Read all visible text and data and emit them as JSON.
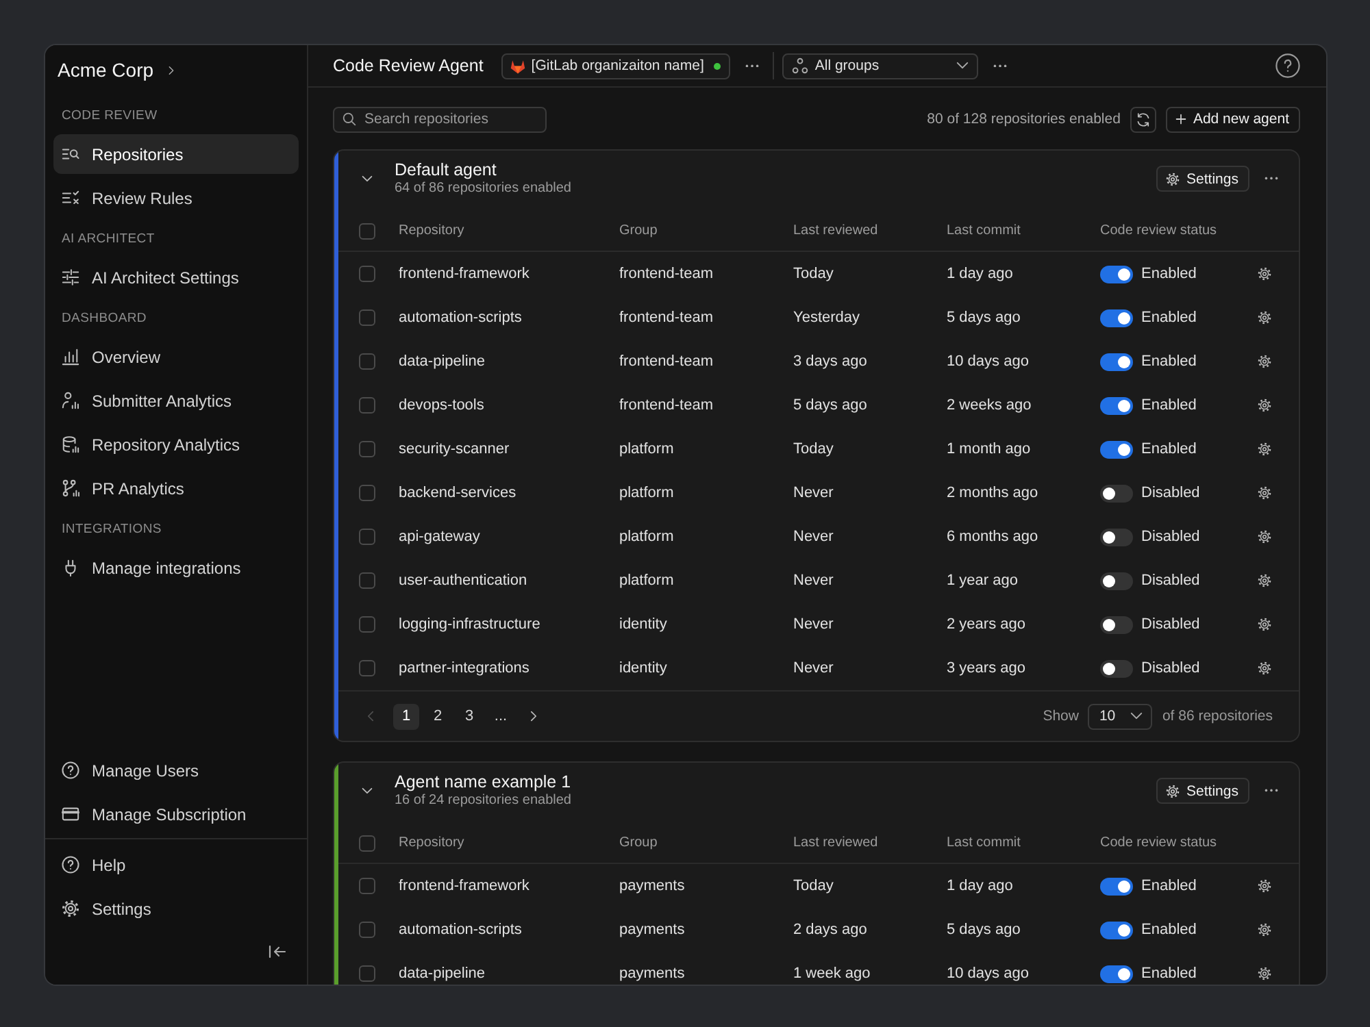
{
  "sidebar": {
    "org_name": "Acme Corp",
    "sections": [
      {
        "heading": "CODE REVIEW",
        "items": [
          {
            "label": "Repositories",
            "selected": true
          },
          {
            "label": "Review Rules",
            "selected": false
          }
        ]
      },
      {
        "heading": "AI ARCHITECT",
        "items": [
          {
            "label": "AI Architect Settings",
            "selected": false
          }
        ]
      },
      {
        "heading": "DASHBOARD",
        "items": [
          {
            "label": "Overview",
            "selected": false
          },
          {
            "label": "Submitter Analytics",
            "selected": false
          },
          {
            "label": "Repository Analytics",
            "selected": false
          },
          {
            "label": "PR Analytics",
            "selected": false
          }
        ]
      },
      {
        "heading": "INTEGRATIONS",
        "items": [
          {
            "label": "Manage integrations",
            "selected": false
          }
        ]
      }
    ],
    "bottom_items": [
      {
        "label": "Manage Users",
        "selected": false
      },
      {
        "label": "Manage Subscription",
        "selected": false
      }
    ],
    "footer_items": [
      {
        "label": "Help",
        "selected": false
      },
      {
        "label": "Settings",
        "selected": false
      }
    ]
  },
  "header": {
    "title": "Code Review Agent",
    "organization": {
      "name": "[GitLab organizaiton name]",
      "connected": true
    },
    "group_filter": {
      "value": "All groups"
    }
  },
  "toolbar": {
    "search": {
      "placeholder": "Search repositories"
    },
    "summary": "80 of 128 repositories enabled",
    "add_button": "Add new agent"
  },
  "agents": [
    {
      "name": "Default agent",
      "summary": "64 of 86 repositories enabled",
      "color": "#2f5fd8",
      "expanded": true,
      "settings_button": "Settings",
      "columns": [
        "Repository",
        "Group",
        "Last reviewed",
        "Last commit",
        "Code review status"
      ],
      "all_selected": false,
      "rows": [
        {
          "checked": false,
          "repository": "frontend-framework",
          "group": "frontend-team",
          "last_reviewed": "Today",
          "last_commit": "1 day ago",
          "enabled": true,
          "status": "Enabled"
        },
        {
          "checked": false,
          "repository": "automation-scripts",
          "group": "frontend-team",
          "last_reviewed": "Yesterday",
          "last_commit": "5 days ago",
          "enabled": true,
          "status": "Enabled"
        },
        {
          "checked": false,
          "repository": "data-pipeline",
          "group": "frontend-team",
          "last_reviewed": "3 days ago",
          "last_commit": "10 days ago",
          "enabled": true,
          "status": "Enabled"
        },
        {
          "checked": false,
          "repository": "devops-tools",
          "group": "frontend-team",
          "last_reviewed": "5 days ago",
          "last_commit": "2 weeks ago",
          "enabled": true,
          "status": "Enabled"
        },
        {
          "checked": false,
          "repository": "security-scanner",
          "group": "platform",
          "last_reviewed": "Today",
          "last_commit": "1 month ago",
          "enabled": true,
          "status": "Enabled"
        },
        {
          "checked": false,
          "repository": "backend-services",
          "group": "platform",
          "last_reviewed": "Never",
          "last_commit": "2 months ago",
          "enabled": false,
          "status": "Disabled"
        },
        {
          "checked": false,
          "repository": "api-gateway",
          "group": "platform",
          "last_reviewed": "Never",
          "last_commit": "6 months ago",
          "enabled": false,
          "status": "Disabled"
        },
        {
          "checked": false,
          "repository": "user-authentication",
          "group": "platform",
          "last_reviewed": "Never",
          "last_commit": "1 year ago",
          "enabled": false,
          "status": "Disabled"
        },
        {
          "checked": false,
          "repository": "logging-infrastructure",
          "group": "identity",
          "last_reviewed": "Never",
          "last_commit": "2 years ago",
          "enabled": false,
          "status": "Disabled"
        },
        {
          "checked": false,
          "repository": "partner-integrations",
          "group": "identity",
          "last_reviewed": "Never",
          "last_commit": "3 years ago",
          "enabled": false,
          "status": "Disabled"
        }
      ],
      "pagination": {
        "previous_disabled": true,
        "pages": [
          {
            "label": "1",
            "selected": true
          },
          {
            "label": "2",
            "selected": false
          },
          {
            "label": "3",
            "selected": false
          },
          {
            "label": "...",
            "selected": false
          }
        ],
        "next_disabled": false,
        "show_label": "Show",
        "page_size": "10",
        "total": "of 86 repositories"
      }
    },
    {
      "name": "Agent name example 1",
      "summary": "16 of 24 repositories enabled",
      "color": "#5a9e2c",
      "expanded": true,
      "settings_button": "Settings",
      "columns": [
        "Repository",
        "Group",
        "Last reviewed",
        "Last commit",
        "Code review status"
      ],
      "all_selected": false,
      "rows": [
        {
          "checked": false,
          "repository": "frontend-framework",
          "group": "payments",
          "last_reviewed": "Today",
          "last_commit": "1 day ago",
          "enabled": true,
          "status": "Enabled"
        },
        {
          "checked": false,
          "repository": "automation-scripts",
          "group": "payments",
          "last_reviewed": "2 days ago",
          "last_commit": "5 days ago",
          "enabled": true,
          "status": "Enabled"
        },
        {
          "checked": false,
          "repository": "data-pipeline",
          "group": "payments",
          "last_reviewed": "1 week ago",
          "last_commit": "10 days ago",
          "enabled": true,
          "status": "Enabled"
        }
      ]
    }
  ]
}
